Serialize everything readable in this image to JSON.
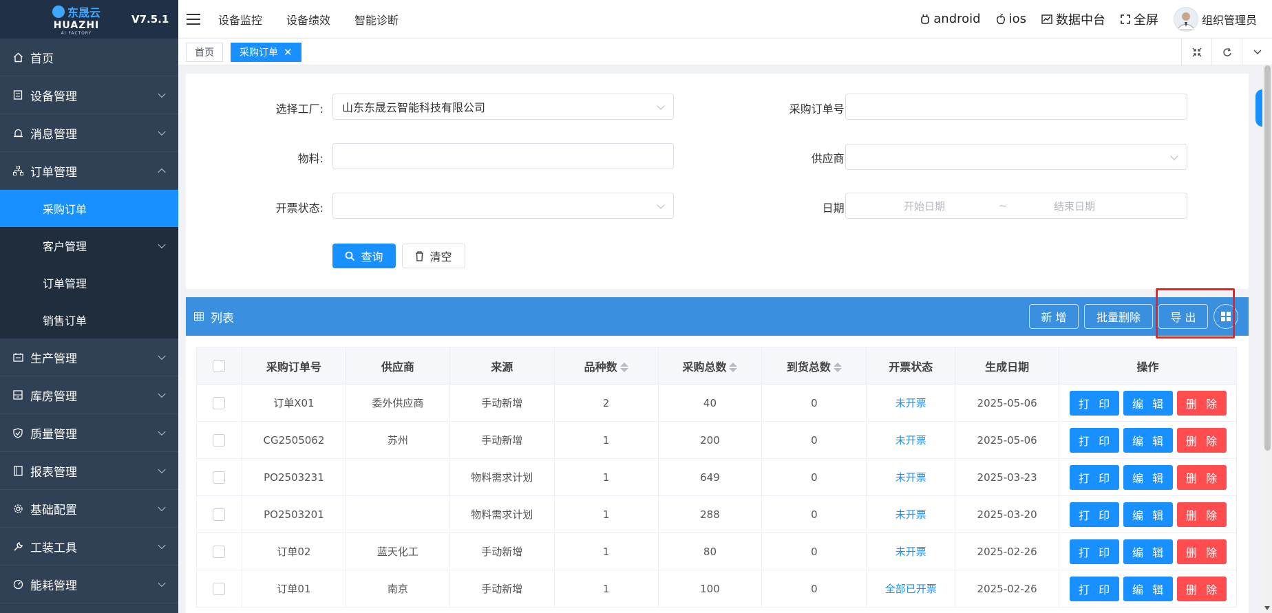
{
  "logo": {
    "brand": "东晟云",
    "name": "HUAZHI",
    "tagline": "AI FACTORY",
    "version": "V7.5.1"
  },
  "sidebar": {
    "items": [
      {
        "label": "首页",
        "icon": "home-icon",
        "chev": false
      },
      {
        "label": "设备管理",
        "icon": "device-icon",
        "chev": true
      },
      {
        "label": "消息管理",
        "icon": "alarm-icon",
        "chev": true
      },
      {
        "label": "订单管理",
        "icon": "org-icon",
        "chev": true,
        "expanded": true
      },
      {
        "label": "生产管理",
        "icon": "production-icon",
        "chev": true
      },
      {
        "label": "库房管理",
        "icon": "warehouse-icon",
        "chev": true
      },
      {
        "label": "质量管理",
        "icon": "shield-icon",
        "chev": true
      },
      {
        "label": "报表管理",
        "icon": "report-icon",
        "chev": true
      },
      {
        "label": "基础配置",
        "icon": "gear-icon",
        "chev": true
      },
      {
        "label": "工装工具",
        "icon": "wrench-icon",
        "chev": true
      },
      {
        "label": "能耗管理",
        "icon": "gauge-icon",
        "chev": true
      }
    ],
    "subitems": [
      {
        "label": "采购订单",
        "active": true,
        "chev": false
      },
      {
        "label": "客户管理",
        "active": false,
        "chev": true
      },
      {
        "label": "订单管理",
        "active": false,
        "chev": false
      },
      {
        "label": "销售订单",
        "active": false,
        "chev": false
      }
    ]
  },
  "topbar": {
    "nav": [
      "设备监控",
      "设备绩效",
      "智能诊断"
    ],
    "android": "android",
    "ios": "ios",
    "data_center": "数据中台",
    "fullscreen": "全屏",
    "user": "组织管理员"
  },
  "tabs": {
    "home": "首页",
    "current": "采购订单"
  },
  "search": {
    "factory_label": "选择工厂:",
    "factory_value": "山东东晟云智能科技有限公司",
    "order_no_label": "采购订单号:",
    "order_no_value": "",
    "material_label": "物料:",
    "material_value": "",
    "supplier_label": "供应商:",
    "supplier_value": "",
    "invoice_label": "开票状态:",
    "invoice_value": "",
    "date_label": "日期:",
    "date_start_placeholder": "开始日期",
    "date_sep": "~",
    "date_end_placeholder": "结束日期",
    "query_btn": "查询",
    "clear_btn": "清空"
  },
  "list": {
    "title": "列表",
    "add_btn": "新 增",
    "batch_delete_btn": "批量删除",
    "export_btn": "导 出",
    "columns": [
      "采购订单号",
      "供应商",
      "来源",
      "品种数",
      "采购总数",
      "到货总数",
      "开票状态",
      "生成日期",
      "操作"
    ],
    "rows": [
      {
        "order_no": "订单X01",
        "supplier": "委外供应商",
        "source": "手动新增",
        "kinds": "2",
        "total": "40",
        "arrived": "0",
        "invoice": "未开票",
        "date": "2025-05-06"
      },
      {
        "order_no": "CG2505062",
        "supplier": "苏州",
        "source": "手动新增",
        "kinds": "1",
        "total": "200",
        "arrived": "0",
        "invoice": "未开票",
        "date": "2025-05-06"
      },
      {
        "order_no": "PO2503231",
        "supplier": "",
        "source": "物料需求计划",
        "kinds": "1",
        "total": "649",
        "arrived": "0",
        "invoice": "未开票",
        "date": "2025-03-23"
      },
      {
        "order_no": "PO2503201",
        "supplier": "",
        "source": "物料需求计划",
        "kinds": "1",
        "total": "288",
        "arrived": "0",
        "invoice": "未开票",
        "date": "2025-03-20"
      },
      {
        "order_no": "订单02",
        "supplier": "蓝天化工",
        "source": "手动新增",
        "kinds": "1",
        "total": "80",
        "arrived": "0",
        "invoice": "未开票",
        "date": "2025-02-26"
      },
      {
        "order_no": "订单01",
        "supplier": "南京",
        "source": "手动新增",
        "kinds": "1",
        "total": "100",
        "arrived": "0",
        "invoice": "全部已开票",
        "date": "2025-02-26"
      }
    ],
    "op_print": "打 印",
    "op_edit": "编 辑",
    "op_delete": "删 除"
  },
  "colors": {
    "primary": "#1890ff",
    "sidebar": "#304156",
    "danger": "#ff4d4f",
    "header_bar": "#3a8fde",
    "highlight": "#ff1a1a"
  }
}
